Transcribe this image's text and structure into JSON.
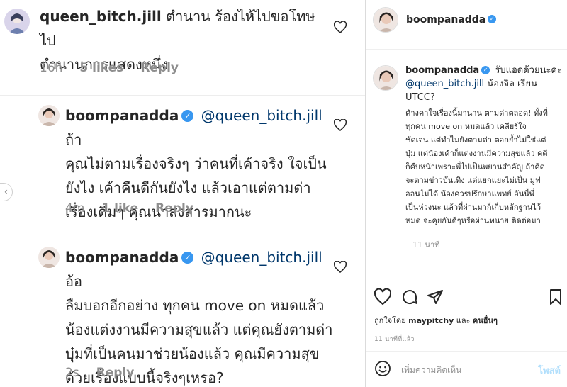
{
  "comments": [
    {
      "username": "queen_bitch.jill",
      "text": "ตำนาน ร้องไห้ไปขอโทษไป",
      "text2": "ตำนานการแสดงหนึ่ง",
      "time": "16h",
      "likes": "5 likes",
      "reply": "Reply"
    },
    {
      "username": "boompanadda",
      "mention": "@queen_bitch.jill",
      "lines": [
        "ถ้า",
        "คุณไม่ตามเรื่องจริงๆ ว่าคนที่เค้าจริง ใจเป็น",
        "ยังไง เค้าคืนดีกันยังไง แล้วเอาแต่ตามด่า",
        "เรื่องเดิมๆ คุณน่าสงสารมากนะ"
      ],
      "time": "4m",
      "likes": "1 like",
      "reply": "Reply"
    },
    {
      "username": "boompanadda",
      "mention": "@queen_bitch.jill",
      "lines": [
        "อ้อ",
        "ลืมบอกอีกอย่าง ทุกคน move on หมดแล้ว",
        "น้องแต่งงานมีความสุขแล้ว แต่คุณยังตามด่า",
        "บุ๋มที่เป็นคนมาช่วยน้องแล้ว คุณมีความสุข",
        "ด้วยเรื่องแบบนี้จริงๆเหรอ?"
      ],
      "time": "2s",
      "reply": "Reply"
    }
  ],
  "post": {
    "username": "boompanadda",
    "caption_head": "รับแอดด้วยนะคะ",
    "caption_mention": "@queen_bitch.jill",
    "caption_tail": "น้องจิล เรียน UTCC?",
    "caption_body": "ค้างคาใจเรื่องนี้มานาน ตามด่าตลอด! ทั้งที่\nทุกคน move on หมดแล้ว เคลียร์ใจ\nชัดเจน แต่ทำไมยังตามด่า ตอกย้ำไม่ใช่แต่\nบุ๋ม แต่น้องเค้าก็แต่งงานมีความสุขแล้ว คดี\nก็คืบหน้าเพราะพี่ไปเป็นพยานสำคัญ ถ้าคิด\nจะตามข่าวบันเทิง แต่แยกแยะไม่เป็น มูฟ\nออนไม่ได้ น้องควรปรึกษาแพทย์ อันนี้พี่\nเป็นห่วงนะ แล้วที่ผ่านมาก็เก็บหลักฐานไว้\nหมด จะคุยกันดีๆหรือผ่านทนาย ติดต่อมา",
    "caption_time": "11 นาที",
    "liked_by_prefix": "ถูกใจโดย",
    "liked_by_user": "maypitchy",
    "liked_by_mid": "และ",
    "liked_by_others": "คนอื่นๆ",
    "post_time": "11 นาทีที่แล้ว",
    "comment_placeholder": "เพิ่มความคิดเห็น",
    "post_button": "โพสต์"
  },
  "colors": {
    "verified": "#3897f0",
    "mention": "#00376b",
    "muted": "#8e8e8e"
  }
}
